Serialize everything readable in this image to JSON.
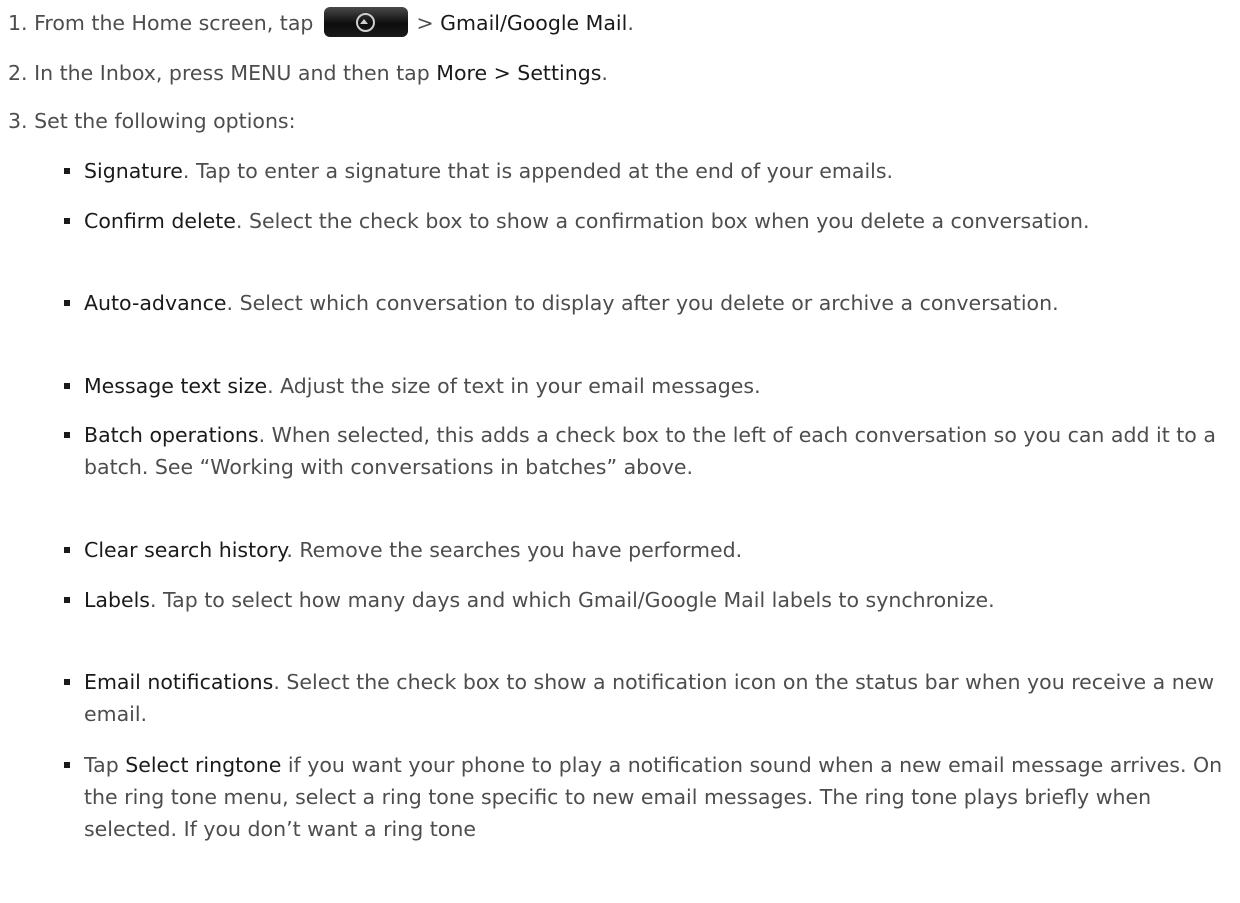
{
  "steps": [
    {
      "num": "1.",
      "pre": "From the Home screen, tap ",
      "mid": " > ",
      "target": "Gmail/Google Mail",
      "post": "."
    },
    {
      "num": "2.",
      "pre": "In the Inbox, press MENU and then tap ",
      "target": "More > Settings",
      "post": "."
    },
    {
      "num": "3.",
      "pre": "Set the following options:"
    }
  ],
  "options": [
    {
      "term": "Signature",
      "desc": ". Tap to enter a signature that is appended at the end of your emails."
    },
    {
      "term": "Confirm delete",
      "desc": ". Select the check box to show a confirmation box when you delete a conversation."
    },
    {
      "term": "Auto-advance",
      "desc": ". Select which conversation to display after you delete or archive a conversation."
    },
    {
      "term": "Message text size",
      "desc": ". Adjust the size of text in your email messages."
    },
    {
      "term": "Batch operations",
      "desc": ". When selected, this adds a check box to the left of each conversation so you can add it to a batch. See “Working with conversations in batches” above."
    },
    {
      "term": "Clear search history",
      "desc": ". Remove the searches you have performed."
    },
    {
      "term": "Labels",
      "desc": ". Tap to select how many days and which Gmail/Google Mail labels to synchronize."
    },
    {
      "term": "Email notifications",
      "desc": ". Select the check box to show a notification icon on the status bar when you receive a new email."
    },
    {
      "pre": "Tap ",
      "term": "Select ringtone",
      "desc": " if you want your phone to play a notification sound when a new email message arrives. On the ring tone menu, select a ring tone specific to new email messages. The ring tone plays briefly when selected. If you don’t want a ring tone"
    }
  ]
}
